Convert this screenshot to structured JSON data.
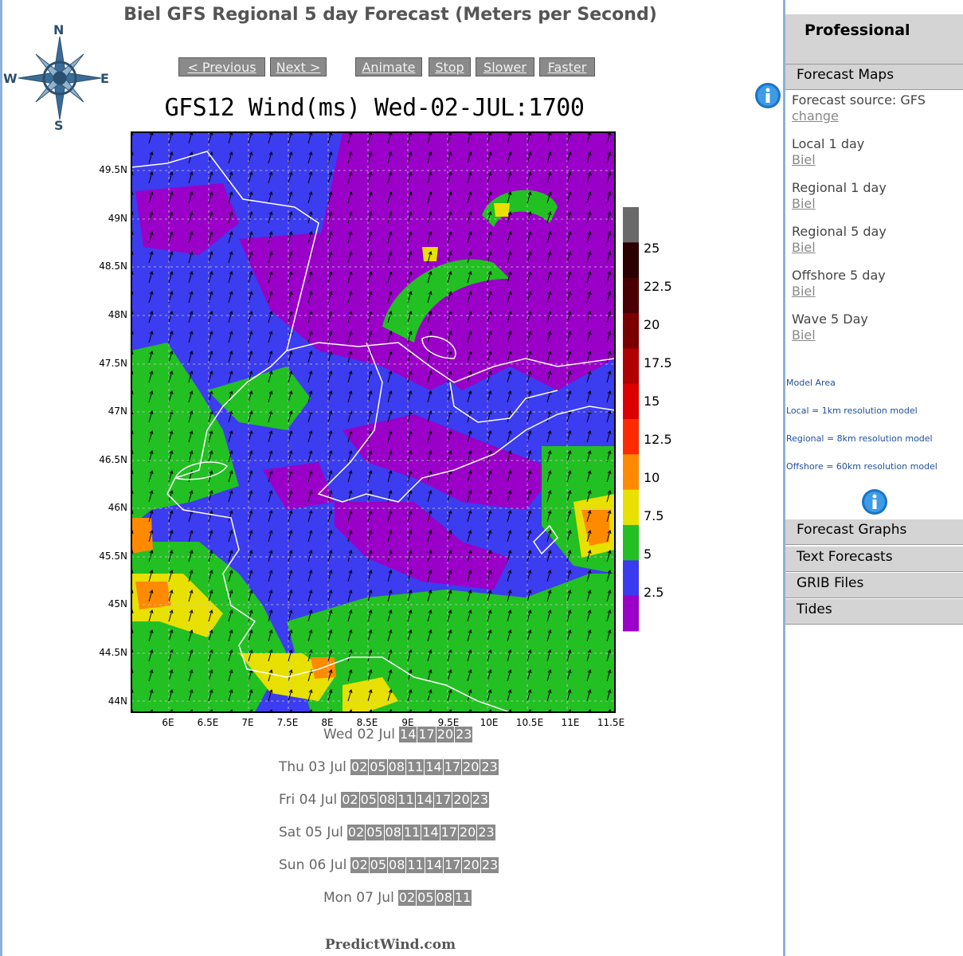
{
  "page": {
    "title": "Biel GFS Regional 5 day Forecast (Meters per Second)",
    "footer": "PredictWind.com"
  },
  "compass": {
    "n": "N",
    "e": "E",
    "s": "S",
    "w": "W"
  },
  "nav_buttons": [
    "< Previous",
    "Next >",
    "Animate",
    "Stop",
    "Slower",
    "Faster"
  ],
  "map": {
    "title": "GFS12 Wind(ms) Wed-02-JUL:1700",
    "lat_labels": [
      "49.5N",
      "49N",
      "48.5N",
      "48N",
      "47.5N",
      "47N",
      "46.5N",
      "46N",
      "45.5N",
      "45N",
      "44.5N",
      "44N"
    ],
    "lon_labels": [
      "6E",
      "6.5E",
      "7E",
      "7.5E",
      "8E",
      "8.5E",
      "9E",
      "9.5E",
      "10E",
      "10.5E",
      "11E",
      "11.5E"
    ],
    "scale_labels": [
      "25",
      "22.5",
      "20",
      "17.5",
      "15",
      "12.5",
      "10",
      "7.5",
      "5",
      "2.5"
    ],
    "scale_colors": [
      "#6a6a6a",
      "#2a0000",
      "#4a0000",
      "#7a0000",
      "#b00000",
      "#dd0000",
      "#ff2a00",
      "#ff8a00",
      "#e8e000",
      "#22c022",
      "#3a3af0",
      "#9a00c8"
    ]
  },
  "days": [
    {
      "label": "Wed 02 Jul",
      "hours": [
        "14",
        "17",
        "20",
        "23"
      ]
    },
    {
      "label": "Thu 03 Jul",
      "hours": [
        "02",
        "05",
        "08",
        "11",
        "14",
        "17",
        "20",
        "23"
      ]
    },
    {
      "label": "Fri 04 Jul",
      "hours": [
        "02",
        "05",
        "08",
        "11",
        "14",
        "17",
        "20",
        "23"
      ]
    },
    {
      "label": "Sat 05 Jul",
      "hours": [
        "02",
        "05",
        "08",
        "11",
        "14",
        "17",
        "20",
        "23"
      ]
    },
    {
      "label": "Sun 06 Jul",
      "hours": [
        "02",
        "05",
        "08",
        "11",
        "14",
        "17",
        "20",
        "23"
      ]
    },
    {
      "label": "Mon 07 Jul",
      "hours": [
        "02",
        "05",
        "08",
        "11"
      ]
    }
  ],
  "sidebar": {
    "professional": "Professional",
    "forecast_maps": "Forecast Maps",
    "source_label": "Forecast source: GFS",
    "change": "change",
    "links": [
      {
        "label": "Local 1 day",
        "location": "Biel"
      },
      {
        "label": "Regional 1 day",
        "location": "Biel"
      },
      {
        "label": "Regional 5 day",
        "location": "Biel"
      },
      {
        "label": "Offshore 5 day",
        "location": "Biel"
      },
      {
        "label": "Wave 5 Day",
        "location": "Biel"
      }
    ],
    "model_notes": [
      "Model Area",
      "Local = 1km resolution model",
      "Regional = 8km resolution model",
      "Offshore = 60km resolution model"
    ],
    "tabs": [
      "Forecast Graphs",
      "Text Forecasts",
      "GRIB Files",
      "Tides"
    ]
  }
}
